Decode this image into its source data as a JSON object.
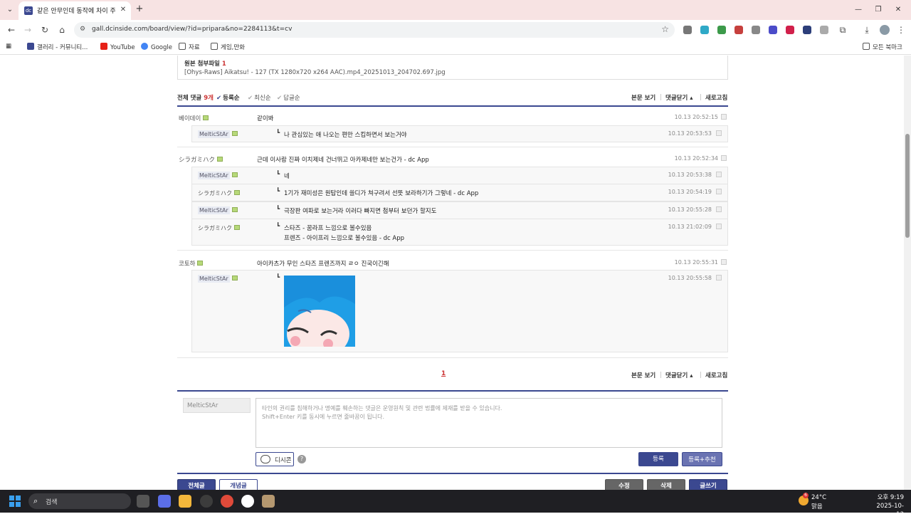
{
  "browser": {
    "tab_title": "같은 안무인데 동작에 차이 주…",
    "url": "gall.dcinside.com/board/view/?id=pripara&no=2284113&t=cv",
    "bookmarks": [
      "갤러리 - 커뮤니티...",
      "YouTube",
      "Google",
      "자료",
      "게임,만화"
    ],
    "all_bookmarks": "모든 북마크"
  },
  "attachment": {
    "label": "원본 첨부파일",
    "count": "1",
    "filename": "[Ohys-Raws] Aikatsu! - 127 (TX 1280x720 x264 AAC).mp4_20251013_204702.697.jpg"
  },
  "comments_header": {
    "total_label": "전체 댓글",
    "total_count": "9개",
    "sort_options": [
      "등록순",
      "최신순",
      "답글순"
    ],
    "view_post": "본문 보기",
    "close_comments": "댓글닫기",
    "refresh": "새로고침"
  },
  "comments": [
    {
      "nick": "베이데이",
      "text": "같이봐",
      "date": "10.13 20:52:15"
    },
    {
      "nick": "シラガミハク",
      "text": "근데 이사람 진짜 이치제네 건너뛰고 아카제네만 보는건가 - dc App",
      "date": "10.13 20:52:34"
    },
    {
      "nick": "코토하",
      "text": "아이카츠가 무인 스타즈 프렌즈까지 ㄹㅇ 진국이긴해",
      "date": "10.13 20:55:31"
    }
  ],
  "replies": [
    {
      "nick": "MelticStAr",
      "text": "나 관심있는 애 나오는 편만 스킵하면서 보는거야",
      "date": "10.13 20:53:53"
    },
    {
      "nick": "MelticStAr",
      "text": "네",
      "date": "10.13 20:53:38"
    },
    {
      "nick": "シラガミハク",
      "text": "1기가 재미성은 원탑인데 쓸디가 쳐구려서 선뜻 보라하기가 그렇네 - dc App",
      "date": "10.13 20:54:19"
    },
    {
      "nick": "MelticStAr",
      "text": "극장판 여파로 보는거라 이러다 빠지면 첨부터 보던가 할지도",
      "date": "10.13 20:55:28"
    },
    {
      "nick": "シラガミハク",
      "text": "스타즈 - 꿈라프 느낌으로 볼수있음",
      "text2": "프렌즈 - 아이프리 느낌으로 볼수있음 - dc App",
      "date": "10.13 21:02:09"
    },
    {
      "nick": "MelticStAr",
      "text": "",
      "date": "10.13 20:55:58"
    }
  ],
  "pagination": {
    "current": "1"
  },
  "write": {
    "writer": "MelticStAr",
    "placeholder_line1": "타인의 권리를 침해하거나 명예를 훼손하는 댓글은 운영원칙 및 관련 법률에 제재를 받을 수 있습니다.",
    "placeholder_line2": "Shift+Enter 키를 동시에 누르면 줄바꿈이 됩니다.",
    "dccon": "디시콘",
    "submit": "등록",
    "submit_recommend": "등록+추천"
  },
  "bottom_buttons": {
    "all": "전체글",
    "concept": "개념글",
    "edit": "수정",
    "delete": "삭제",
    "write": "글쓰기"
  },
  "taskbar": {
    "search": "검색",
    "temp": "24°C",
    "condition": "맑음",
    "time": "오후 9:19",
    "date": "2025-10-13",
    "badge": "6"
  },
  "colors": {
    "accent": "#3b4890",
    "highlight": "#cc3333",
    "tab_bg": "#f7e3e3"
  }
}
